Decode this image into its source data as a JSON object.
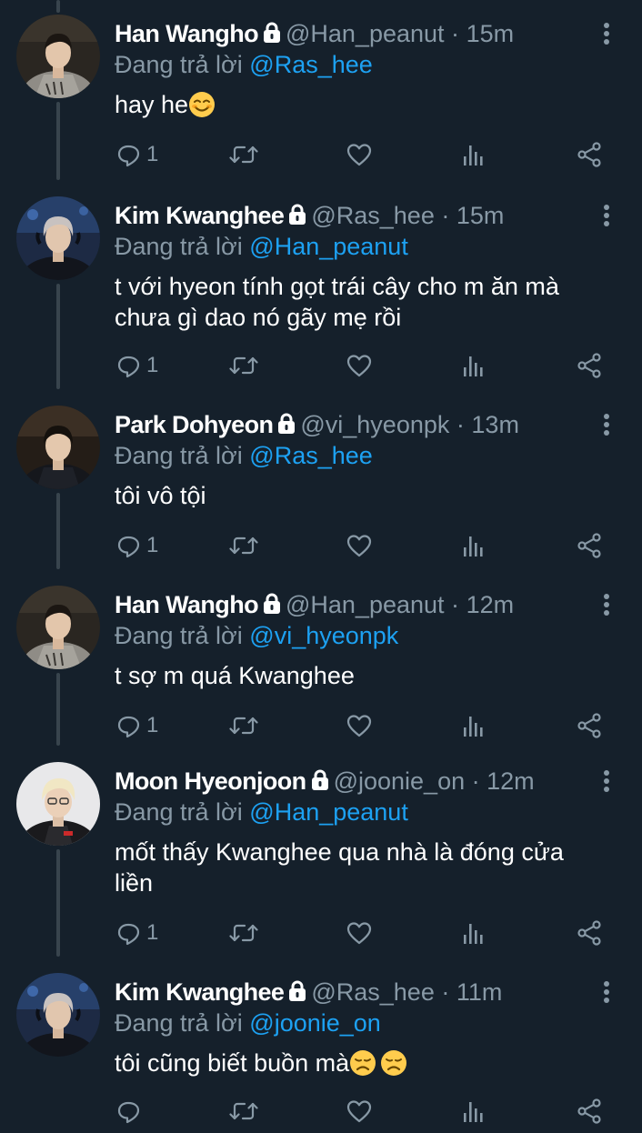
{
  "colors": {
    "background": "#15202b",
    "thread_line": "#38444d",
    "secondary_text": "#8899a6",
    "link": "#1da1f2",
    "primary_text": "#ffffff"
  },
  "tweets": [
    {
      "name": "Han Wangho",
      "handle": "@Han_peanut",
      "separator": "·",
      "time": "15m",
      "reply_prefix": "Đang trả lời",
      "reply_to": "@Ras_hee",
      "text": "hay he",
      "emoji": "smiling-face-icon",
      "reply_count": "1",
      "avatar": "han-wangho-avatar"
    },
    {
      "name": "Kim Kwanghee",
      "handle": "@Ras_hee",
      "separator": "·",
      "time": "15m",
      "reply_prefix": "Đang trả lời",
      "reply_to": "@Han_peanut",
      "text": "t với hyeon tính gọt trái cây cho m ăn mà chưa gì dao nó gãy mẹ rồi",
      "reply_count": "1",
      "avatar": "kim-kwanghee-avatar"
    },
    {
      "name": "Park Dohyeon",
      "handle": "@vi_hyeonpk",
      "separator": "·",
      "time": "13m",
      "reply_prefix": "Đang trả lời",
      "reply_to": "@Ras_hee",
      "text": "tôi vô tội",
      "reply_count": "1",
      "avatar": "park-dohyeon-avatar"
    },
    {
      "name": "Han Wangho",
      "handle": "@Han_peanut",
      "separator": "·",
      "time": "12m",
      "reply_prefix": "Đang trả lời",
      "reply_to": "@vi_hyeonpk",
      "text": "t sợ m quá Kwanghee",
      "reply_count": "1",
      "avatar": "han-wangho-avatar"
    },
    {
      "name": "Moon Hyeonjoon",
      "handle": "@joonie_on",
      "separator": "·",
      "time": "12m",
      "reply_prefix": "Đang trả lời",
      "reply_to": "@Han_peanut",
      "text": "mốt thấy Kwanghee qua nhà là đóng cửa liền",
      "reply_count": "1",
      "avatar": "moon-hyeonjoon-avatar"
    },
    {
      "name": "Kim Kwanghee",
      "handle": "@Ras_hee",
      "separator": "·",
      "time": "11m",
      "reply_prefix": "Đang trả lời",
      "reply_to": "@joonie_on",
      "text": "tôi cũng biết buồn mà",
      "emoji": "sad-face-icon",
      "reply_count": "",
      "avatar": "kim-kwanghee-avatar"
    }
  ]
}
